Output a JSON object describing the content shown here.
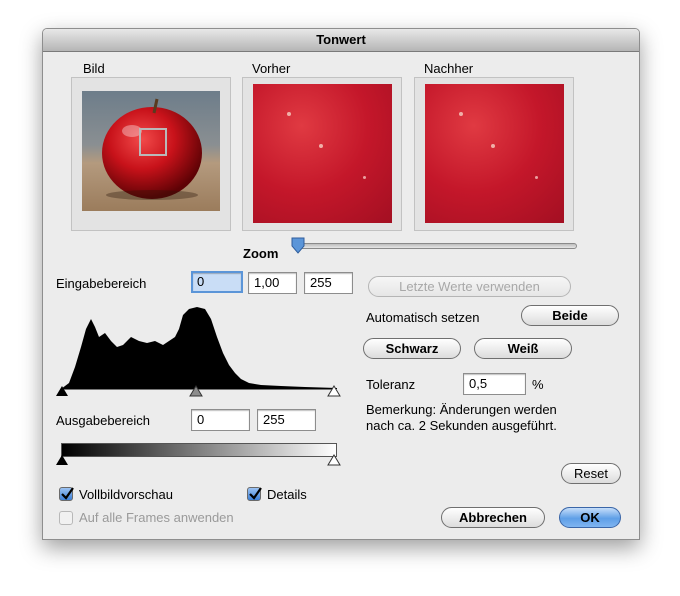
{
  "window": {
    "title": "Tonwert"
  },
  "previews": {
    "image_label": "Bild",
    "before_label": "Vorher",
    "after_label": "Nachher"
  },
  "zoom": {
    "label": "Zoom"
  },
  "input_range": {
    "label": "Eingabebereich",
    "black": "0",
    "gamma": "1,00",
    "white": "255"
  },
  "last_values_button": "Letzte Werte verwenden",
  "auto": {
    "label": "Automatisch setzen",
    "both_button": "Beide",
    "black_button": "Schwarz",
    "white_button": "Weiß"
  },
  "tolerance": {
    "label": "Toleranz",
    "value": "0,5",
    "unit": "%"
  },
  "note": {
    "line1": "Bemerkung: Änderungen werden",
    "line2": "nach ca. 2 Sekunden ausgeführt."
  },
  "output_range": {
    "label": "Ausgabebereich",
    "black": "0",
    "white": "255"
  },
  "options": {
    "fullscreen_preview": {
      "label": "Vollbildvorschau",
      "checked": true
    },
    "details": {
      "label": "Details",
      "checked": true
    },
    "all_frames": {
      "label": "Auf alle Frames anwenden",
      "checked": false,
      "enabled": false
    }
  },
  "buttons": {
    "reset": "Reset",
    "cancel": "Abbrechen",
    "ok": "OK"
  }
}
